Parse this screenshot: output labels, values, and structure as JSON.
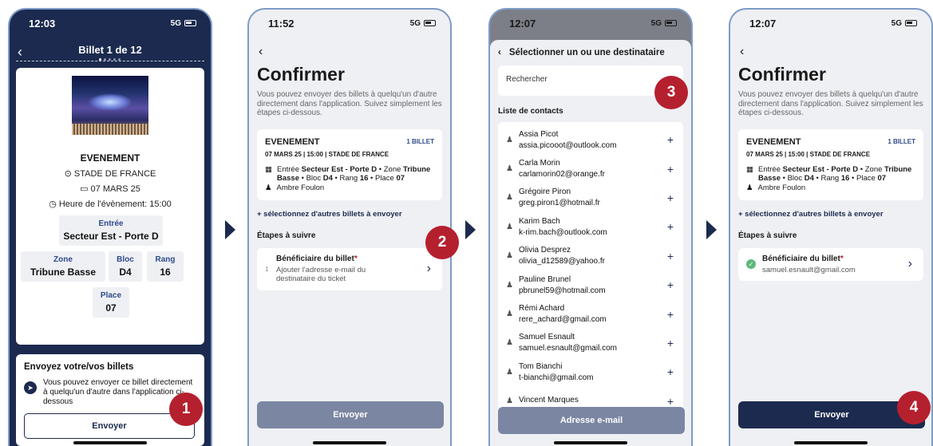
{
  "colors": {
    "navy": "#1b2a4e",
    "badge": "#b5202e",
    "disabled": "#7b86a2",
    "link": "#2f4a8a"
  },
  "phone1": {
    "time": "12:03",
    "network": "5G",
    "title": "Billet 1 de 12",
    "ticket": {
      "event": "EVENEMENT",
      "venue": "STADE DE FRANCE",
      "date": "07 MARS 25",
      "time_label": "Heure de l'évènement: 15:00",
      "entree_label": "Entrée",
      "entree_value": "Secteur Est - Porte D",
      "zone_label": "Zone",
      "zone_value": "Tribune Basse",
      "bloc_label": "Bloc",
      "bloc_value": "D4",
      "rang_label": "Rang",
      "rang_value": "16",
      "place_label": "Place",
      "place_value": "07"
    },
    "send_title": "Envoyez votre/vos billets",
    "send_text": "Vous pouvez envoyer ce billet directement à quelqu'un d'autre dans l'application ci-dessous",
    "send_button": "Envoyer",
    "badge": "1"
  },
  "phone2": {
    "time": "11:52",
    "network": "5G",
    "badge": "2",
    "button": "Envoyer"
  },
  "phone3": {
    "time": "12:07",
    "network": "5G",
    "header": "Sélectionner un ou une destinataire",
    "search_placeholder": "Rechercher",
    "list_title": "Liste de contacts",
    "contacts": [
      {
        "name": "Assia Picot",
        "email": "assia.picooot@outlook.com"
      },
      {
        "name": "Carla Morin",
        "email": "carlamorin02@orange.fr"
      },
      {
        "name": "Grégoire Piron",
        "email": "greg.piron1@hotmail.fr"
      },
      {
        "name": "Karim Bach",
        "email": "k-rim.bach@outlook.com"
      },
      {
        "name": "Olivia Desprez",
        "email": "olivia_d12589@yahoo.fr"
      },
      {
        "name": "Pauline Brunel",
        "email": "pbrunel59@hotmail.com"
      },
      {
        "name": "Rémi Achard",
        "email": "rere_achard@gmail.com"
      },
      {
        "name": "Samuel Esnault",
        "email": "samuel.esnault@gmail.com"
      },
      {
        "name": "Tom Bianchi",
        "email": "t-bianchi@gmail.com"
      },
      {
        "name": "Vincent Marques",
        "email": ""
      }
    ],
    "button": "Adresse e-mail",
    "badge": "3"
  },
  "phone4": {
    "time": "12:07",
    "network": "5G",
    "badge": "4",
    "button": "Envoyer"
  },
  "confirm": {
    "title": "Confirmer",
    "intro": "Vous pouvez envoyer des billets à quelqu'un d'autre directement dans l'application. Suivez simplement les étapes ci-dessous.",
    "event": "EVENEMENT",
    "count": "1 BILLET",
    "date": "07 MARS 25 | 15:00 | STADE DE FRANCE",
    "d_entree": "Entrée ",
    "d_entree_val": "Secteur Est - Porte D",
    "d_zone": " • Zone ",
    "d_zone_val": "Tribune Basse",
    "d_bloc": " • Bloc ",
    "d_bloc_val": "D4",
    "d_rang": " • Rang ",
    "d_rang_val": "16",
    "d_place": " • Place ",
    "d_place_val": "07",
    "person": "Ambre Foulon",
    "more": "+ sélectionnez d'autres billets à envoyer",
    "steps": "Étapes à suivre",
    "step_num": "1",
    "step_title": "Bénéficiaire du billet",
    "step_req": "*",
    "step_sub": "Ajouter l'adresse e-mail du destinataire du ticket",
    "step_done_email": "samuel.esnault@gmail.com"
  }
}
